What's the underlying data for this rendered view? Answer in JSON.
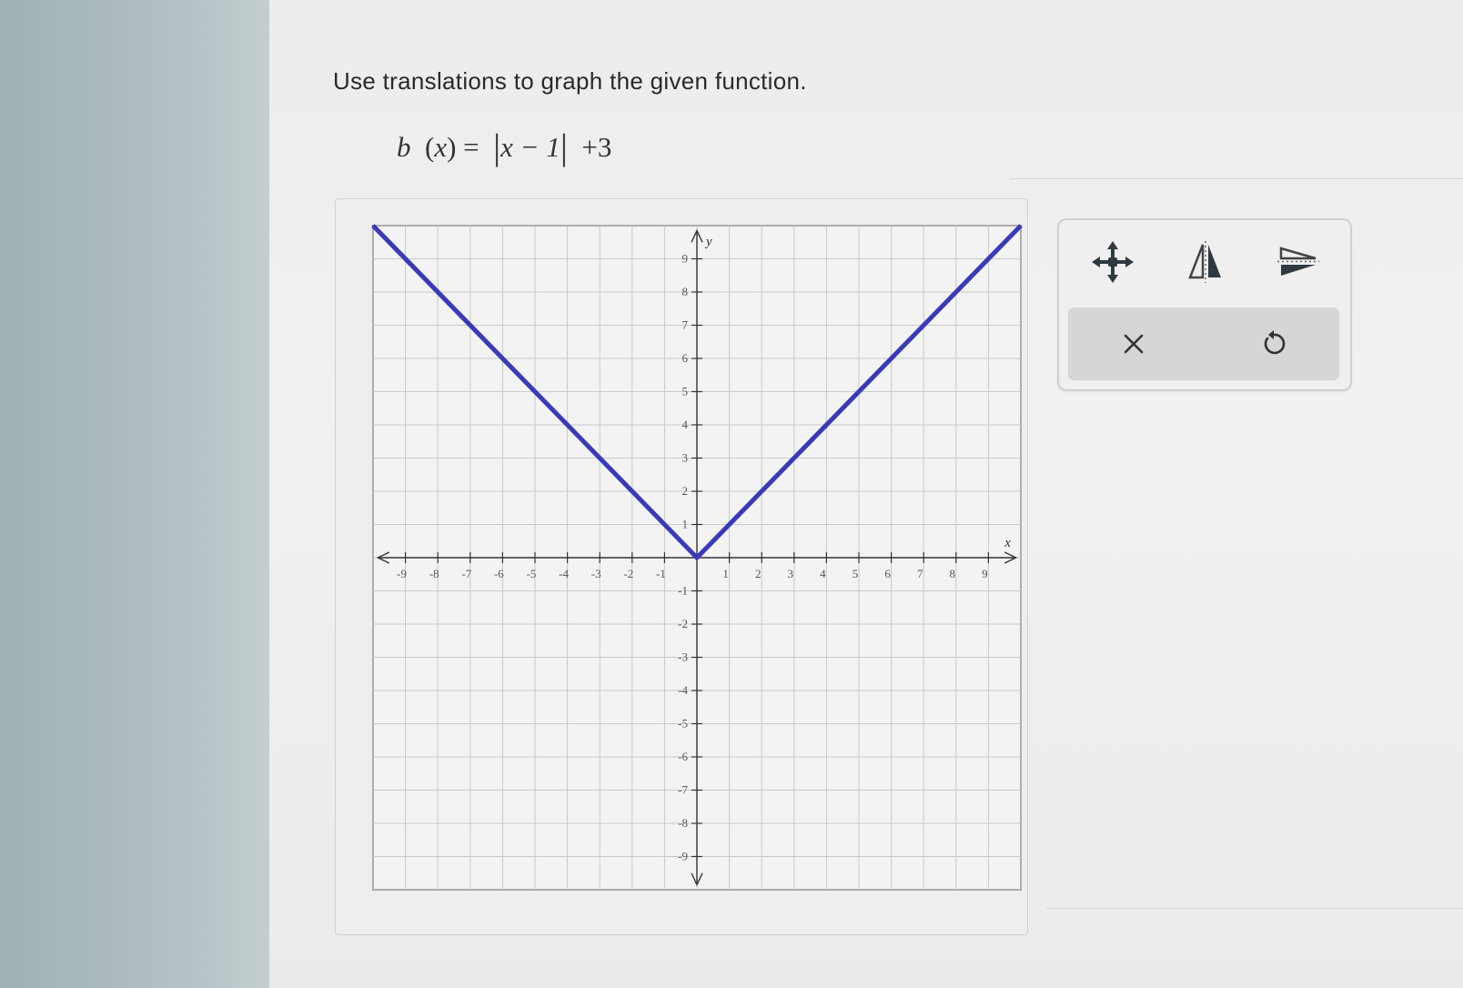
{
  "question": {
    "prompt": "Use translations to graph the given function.",
    "equation": {
      "func": "b",
      "var": "x",
      "inner": "x − 1",
      "outside": "+3"
    }
  },
  "graph": {
    "axis_labels": {
      "x": "x",
      "y": "y"
    },
    "x_ticks": [
      "-9",
      "-8",
      "-7",
      "-6",
      "-5",
      "-4",
      "-3",
      "-2",
      "-1",
      "1",
      "2",
      "3",
      "4",
      "5",
      "6",
      "7",
      "8",
      "9"
    ],
    "y_ticks": [
      "9",
      "8",
      "7",
      "6",
      "5",
      "4",
      "3",
      "2",
      "1",
      "-1",
      "-2",
      "-3",
      "-4",
      "-5",
      "-6",
      "-7",
      "-8",
      "-9"
    ],
    "line_color": "#3a3ab8"
  },
  "chart_data": {
    "type": "line",
    "xlim": [
      -10,
      10
    ],
    "ylim": [
      -10,
      10
    ],
    "grid": true,
    "series": [
      {
        "x": [
          -10,
          0,
          10
        ],
        "y": [
          10,
          0,
          10
        ]
      }
    ]
  },
  "toolbox": {
    "tools": [
      "move-icon",
      "reflect-vertical-icon",
      "reflect-horizontal-icon"
    ],
    "actions": [
      "delete-icon",
      "undo-icon"
    ]
  }
}
